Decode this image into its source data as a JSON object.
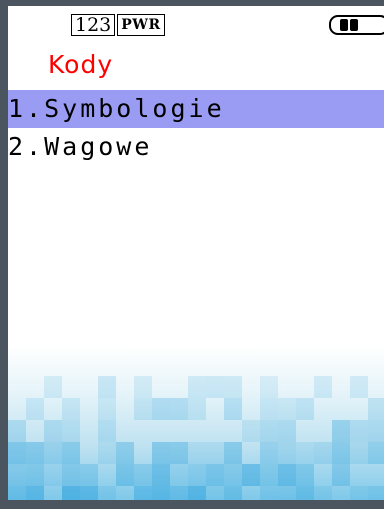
{
  "status_bar": {
    "input_mode": "123",
    "power_mode": "PWR",
    "battery_level": 0.4
  },
  "screen": {
    "title": "Kody",
    "menu": [
      {
        "label": "1.Symbologie",
        "selected": true
      },
      {
        "label": "2.Wagowe",
        "selected": false
      }
    ]
  },
  "colors": {
    "title": "#ff0000",
    "selection": "#9a9cf4",
    "frame": "#4a5560",
    "wallpaper": "#7fc9ea"
  }
}
